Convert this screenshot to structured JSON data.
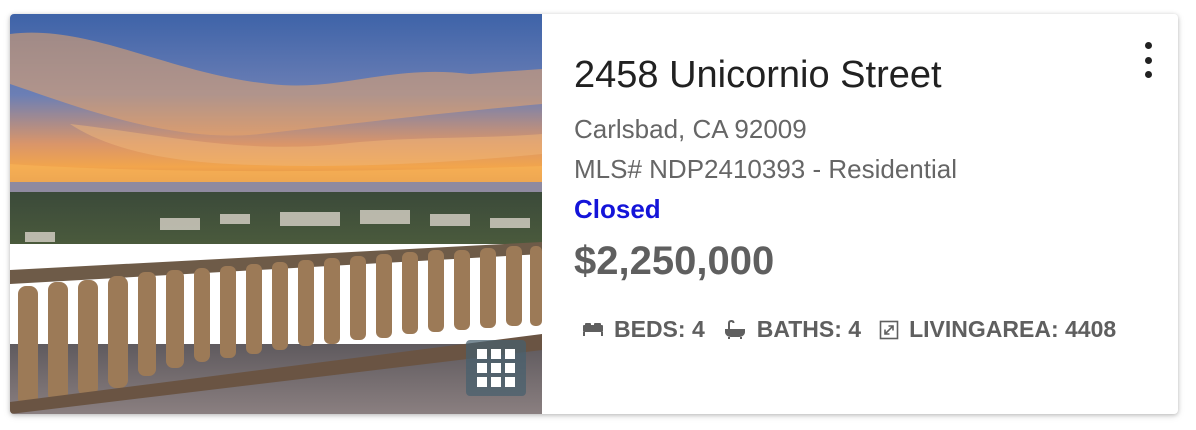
{
  "listing": {
    "address": "2458 Unicornio Street",
    "city_line": "Carlsbad, CA 92009",
    "mls_line": "MLS# NDP2410393 - Residential",
    "status": "Closed",
    "price": "$2,250,000",
    "features": {
      "beds": "BEDS: 4",
      "baths": "BATHS: 4",
      "living_area": "LIVINGAREA: 4408"
    }
  },
  "icons": {
    "more": "more-vertical-icon",
    "gallery": "grid-icon",
    "beds": "bed-icon",
    "baths": "bathtub-icon",
    "living_area": "expand-icon"
  },
  "colors": {
    "status": "#1414d9",
    "price": "#5f5f5f",
    "secondary_text": "#666666"
  }
}
